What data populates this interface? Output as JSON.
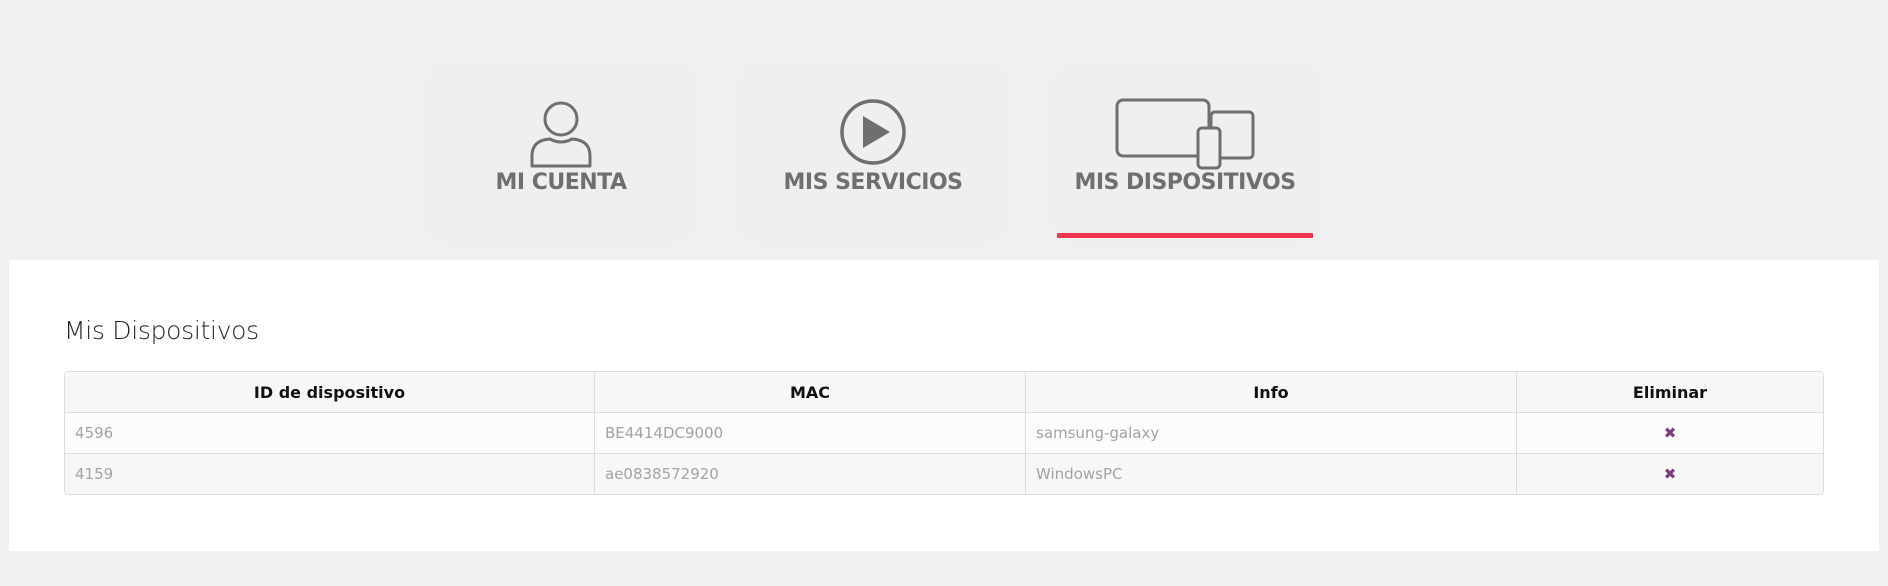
{
  "tabs": [
    {
      "label": "MI CUENTA",
      "icon": "user-icon",
      "active": false
    },
    {
      "label": "MIS SERVICIOS",
      "icon": "play-icon",
      "active": false
    },
    {
      "label": "MIS DISPOSITIVOS",
      "icon": "devices-icon",
      "active": true
    }
  ],
  "colors": {
    "accent": "#ef344e",
    "delete": "#7a3e7c",
    "icon": "#6f6f6f"
  },
  "panel": {
    "title": "Mis Dispositivos",
    "table": {
      "headers": [
        "ID de dispositivo",
        "MAC",
        "Info",
        "Eliminar"
      ],
      "rows": [
        {
          "id": "4596",
          "mac": "BE4414DC9000",
          "info": "samsung-galaxy",
          "delete_icon": "close-icon"
        },
        {
          "id": "4159",
          "mac": "ae0838572920",
          "info": "WindowsPC",
          "delete_icon": "close-icon"
        }
      ]
    }
  }
}
